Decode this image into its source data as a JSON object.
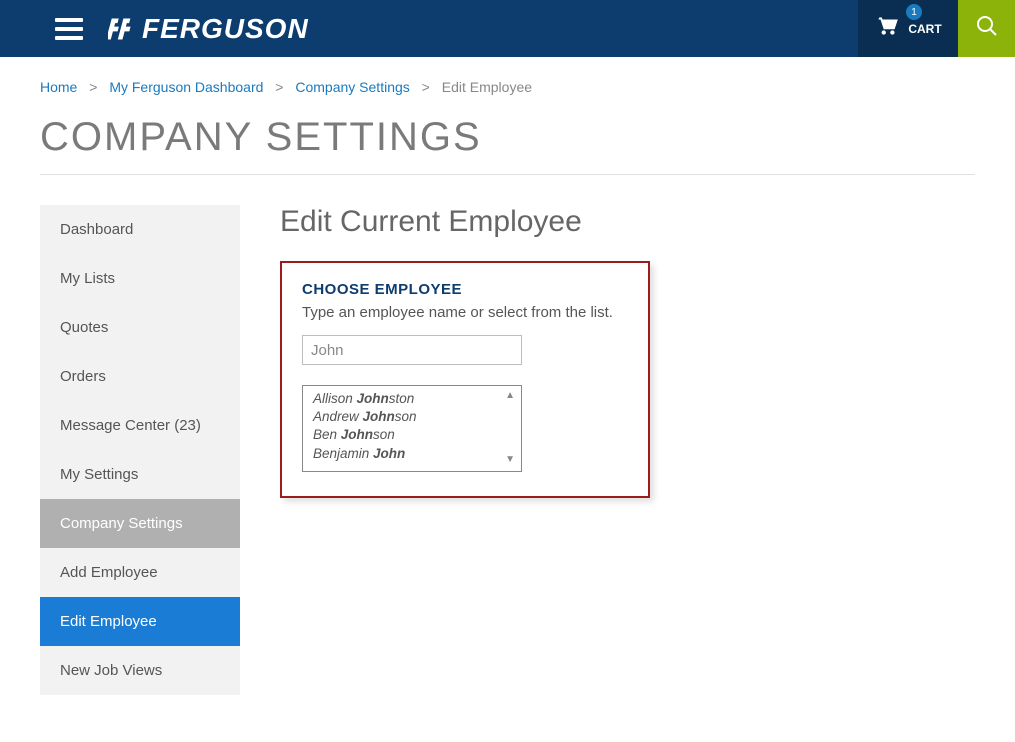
{
  "header": {
    "logo_text": "FERGUSON",
    "cart_label": "CART",
    "cart_count": "1"
  },
  "breadcrumb": {
    "items": [
      "Home",
      "My Ferguson Dashboard",
      "Company Settings",
      "Edit Employee"
    ]
  },
  "page_title": "COMPANY SETTINGS",
  "sidebar": {
    "items": [
      {
        "label": "Dashboard"
      },
      {
        "label": "My Lists"
      },
      {
        "label": "Quotes"
      },
      {
        "label": "Orders"
      },
      {
        "label": "Message Center (23)"
      },
      {
        "label": "My Settings"
      },
      {
        "label": "Company Settings",
        "selected": true
      },
      {
        "label": "Add Employee"
      },
      {
        "label": "Edit Employee",
        "highlight": true
      },
      {
        "label": "New Job Views"
      }
    ]
  },
  "main": {
    "heading": "Edit Current Employee",
    "panel": {
      "title": "CHOOSE EMPLOYEE",
      "instruction": "Type an employee name or select from the list.",
      "input_value": "John",
      "results": [
        {
          "pre": "Allison ",
          "bold": "John",
          "post": "ston"
        },
        {
          "pre": "Andrew ",
          "bold": "John",
          "post": "son"
        },
        {
          "pre": "Ben ",
          "bold": "John",
          "post": "son"
        },
        {
          "pre": "Benjamin ",
          "bold": "John",
          "post": ""
        }
      ]
    }
  }
}
